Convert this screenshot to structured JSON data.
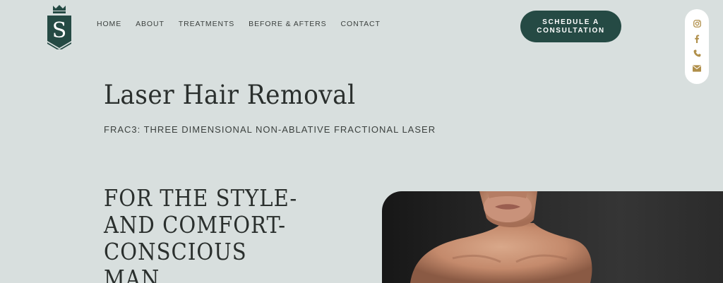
{
  "brand": {
    "logo_letter": "S"
  },
  "nav": {
    "items": [
      "HOME",
      "ABOUT",
      "TREATMENTS",
      "BEFORE & AFTERS",
      "CONTACT"
    ]
  },
  "cta": {
    "label": "SCHEDULE A CONSULTATION"
  },
  "social": {
    "icons": [
      "instagram-icon",
      "facebook-icon",
      "phone-icon",
      "email-icon"
    ],
    "color": "#b08f4a"
  },
  "hero": {
    "title": "Laser Hair Removal",
    "subtitle": "FRAC3: THREE DIMENSIONAL NON-ABLATIVE FRACTIONAL LASER"
  },
  "section": {
    "headline": "FOR THE STYLE-AND COMFORT-CONSCIOUS MAN"
  },
  "colors": {
    "background": "#d8dfde",
    "brand_green": "#254a44",
    "text": "#2e3432"
  }
}
